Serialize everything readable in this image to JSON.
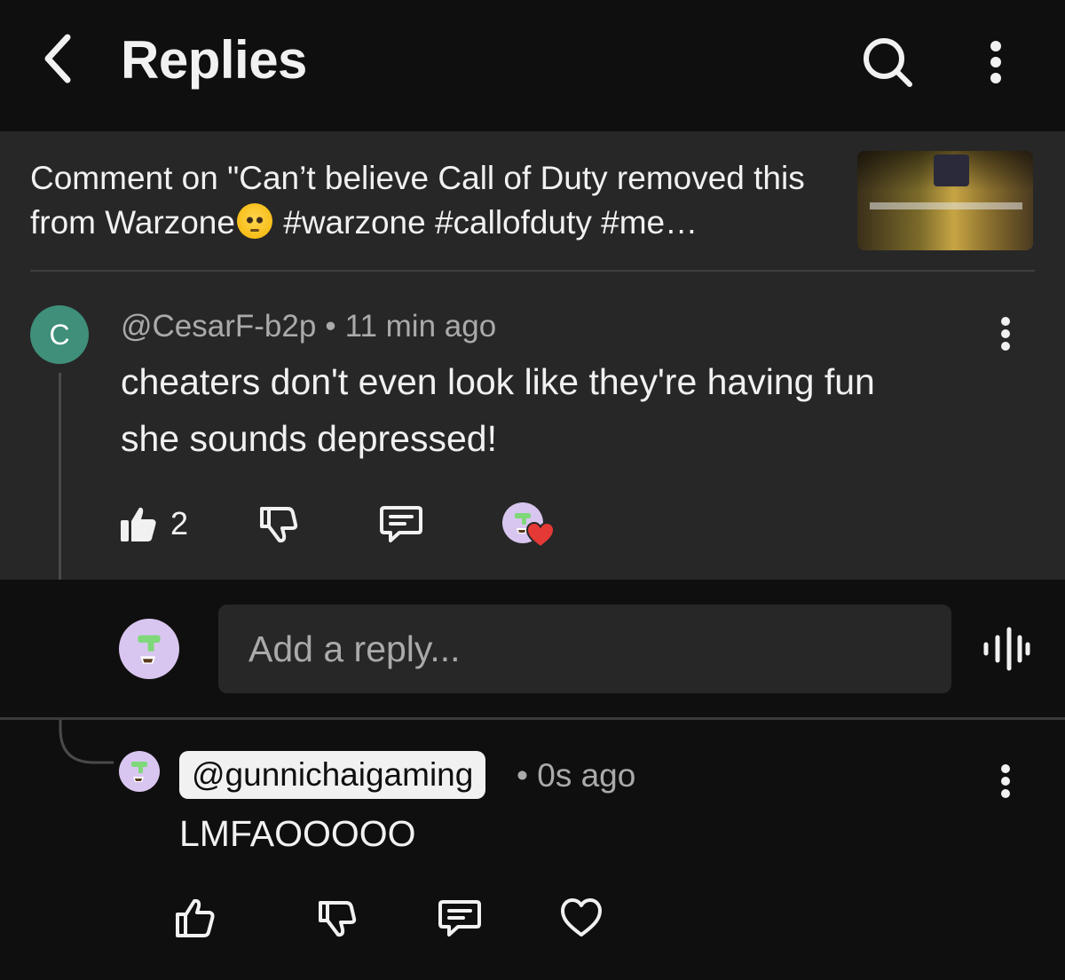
{
  "header": {
    "title": "Replies",
    "back_icon": "chevron-left-icon",
    "search_icon": "search-icon",
    "more_icon": "more-vertical-icon"
  },
  "video_context": {
    "text_before_emoji": "Comment on \"Can’t believe Call of Duty removed this from Warzone",
    "emoji": "flushed-face-emoji",
    "text_after_emoji": " #warzone #callofduty #me…",
    "thumbnail": "video-thumbnail"
  },
  "parent_comment": {
    "avatar_letter": "C",
    "author": "@CesarF-b2p",
    "separator": "•",
    "time": "11 min ago",
    "text_lines": [
      "cheaters don't even look like they're having fun",
      "she sounds depressed!"
    ],
    "like_count": "2",
    "creator_hearted": true
  },
  "reply_input": {
    "placeholder": "Add a reply...",
    "voice_icon": "voice-waveform-icon"
  },
  "reply": {
    "author": "@gunnichaigaming",
    "separator": "•",
    "time": "0s ago",
    "text": "LMFAOOOOO"
  },
  "colors": {
    "background": "#0f0f0f",
    "panel": "#272727",
    "text_primary": "#f1f1f1",
    "text_secondary": "#aaaaaa",
    "avatar_c": "#3f8f7a",
    "user_avatar": "#d9c6f0",
    "heart": "#e53935"
  }
}
